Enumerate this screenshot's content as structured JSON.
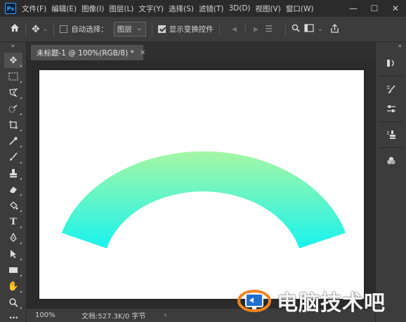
{
  "app": {
    "logo": "Ps"
  },
  "menubar": {
    "items": [
      "文件(F)",
      "编辑(E)",
      "图像(I)",
      "图层(L)",
      "文字(Y)",
      "选择(S)",
      "滤镜(T)",
      "3D(D)",
      "视图(V)",
      "窗口(W)"
    ],
    "window_controls": {
      "minimize": "—",
      "maximize": "☐",
      "close": "✕"
    }
  },
  "options": {
    "home_icon": "home-icon",
    "move_icon": "move-tool-icon",
    "auto_select_label": "自动选择：",
    "auto_select_checked": false,
    "target_dropdown": "图层",
    "show_transform_label": "显示变换控件",
    "show_transform_checked": true
  },
  "document": {
    "tab_title": "未标题-1 @ 100%(RGB/8) *",
    "tab_close": "×"
  },
  "status": {
    "zoom": "100%",
    "doc_info": "文档:527.3K/0 字节",
    "arrow": "›"
  },
  "toolbar": {
    "tools": [
      "move",
      "marquee",
      "lasso",
      "quick-select",
      "crop",
      "eyedropper",
      "brush",
      "clone-stamp",
      "eraser",
      "paint-bucket",
      "type",
      "pen",
      "path-select",
      "rectangle",
      "hand",
      "zoom",
      "more"
    ],
    "type_glyph": "T",
    "more_glyph": "•••"
  },
  "artwork": {
    "gradient_top": "#a6f7a4",
    "gradient_bottom": "#19f3ee"
  },
  "watermark": {
    "text": "电脑技术吧"
  }
}
